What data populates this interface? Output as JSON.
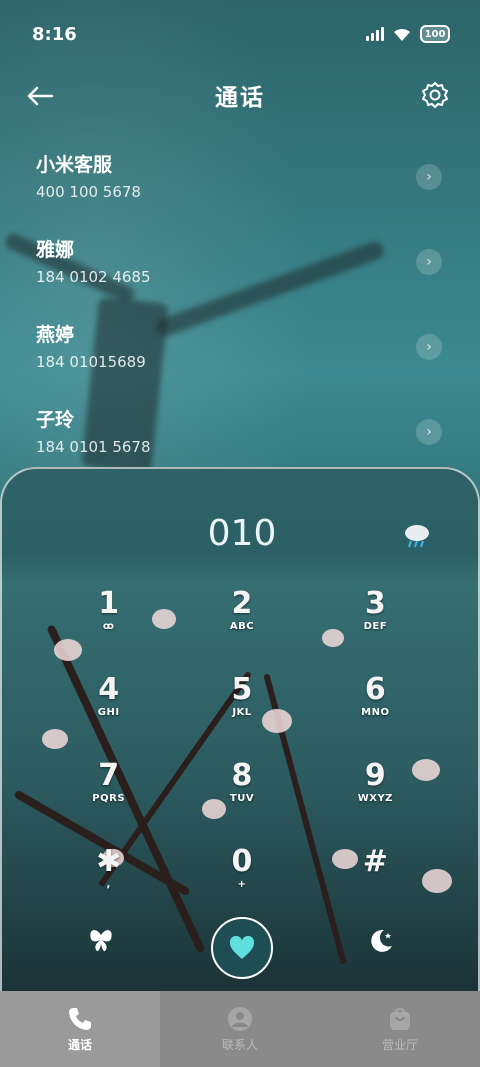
{
  "status": {
    "time": "8:16",
    "battery": "100"
  },
  "header": {
    "title": "通话"
  },
  "contacts": [
    {
      "name": "小米客服",
      "number": "400 100 5678"
    },
    {
      "name": "雅娜",
      "number": "184 0102 4685"
    },
    {
      "name": "燕婷",
      "number": "184 01015689"
    },
    {
      "name": "子玲",
      "number": "184 0101 5678"
    }
  ],
  "dialpad": {
    "input": "010",
    "keys": [
      {
        "digit": "1",
        "letters": "ꝏ"
      },
      {
        "digit": "2",
        "letters": "ABC"
      },
      {
        "digit": "3",
        "letters": "DEF"
      },
      {
        "digit": "4",
        "letters": "GHI"
      },
      {
        "digit": "5",
        "letters": "JKL"
      },
      {
        "digit": "6",
        "letters": "MNO"
      },
      {
        "digit": "7",
        "letters": "PQRS"
      },
      {
        "digit": "8",
        "letters": "TUV"
      },
      {
        "digit": "9",
        "letters": "WXYZ"
      },
      {
        "digit": "✱",
        "letters": ","
      },
      {
        "digit": "0",
        "letters": "+"
      },
      {
        "digit": "#",
        "letters": ""
      }
    ]
  },
  "tabbar": [
    {
      "label": "通话",
      "icon": "phone-icon",
      "active": true
    },
    {
      "label": "联系人",
      "icon": "person-icon",
      "active": false
    },
    {
      "label": "营业厅",
      "icon": "bag-icon",
      "active": false
    }
  ],
  "colors": {
    "accent": "#3fd0d0",
    "background": "#2f5f63"
  }
}
